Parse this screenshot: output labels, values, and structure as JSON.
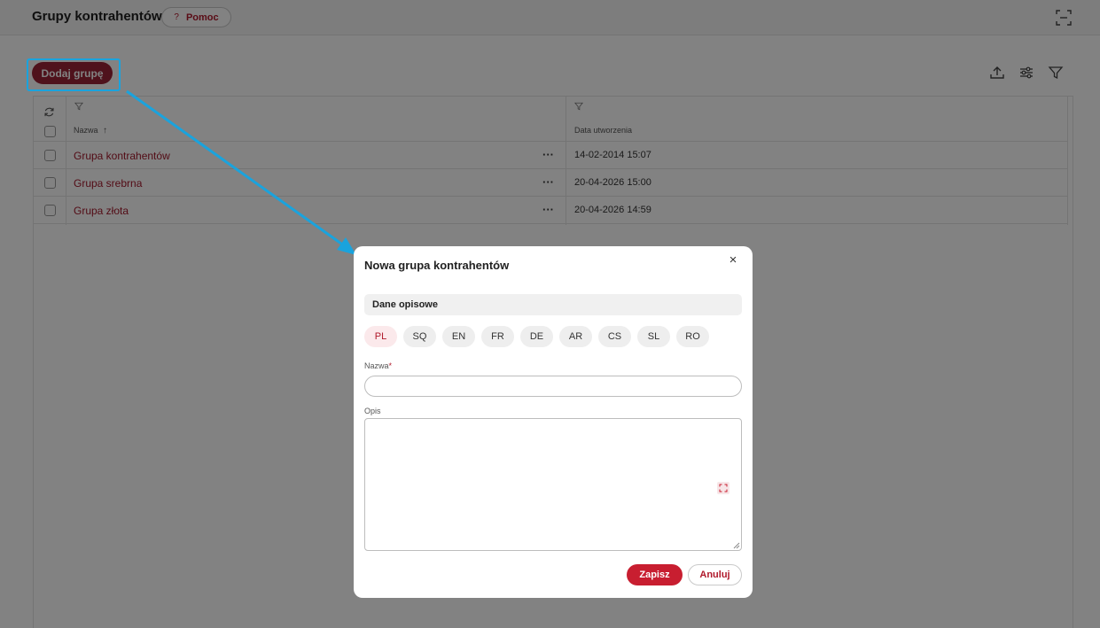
{
  "header": {
    "title": "Grupy kontrahentów",
    "help_label": "Pomoc",
    "help_icon": "?"
  },
  "toolbar": {
    "add_label": "Dodaj grupę"
  },
  "table": {
    "columns": [
      {
        "label": "Nazwa",
        "sort": "↑"
      },
      {
        "label": "Data utworzenia"
      }
    ],
    "rows": [
      {
        "name": "Grupa kontrahentów",
        "date": "14-02-2014 15:07",
        "menu": "···"
      },
      {
        "name": "Grupa srebrna",
        "date": "20-04-2026 15:00",
        "menu": "···"
      },
      {
        "name": "Grupa złota",
        "date": "20-04-2026 14:59",
        "menu": "···"
      }
    ]
  },
  "modal": {
    "title": "Nowa grupa kontrahentów",
    "close": "×",
    "section": "Dane opisowe",
    "languages": [
      "PL",
      "SQ",
      "EN",
      "FR",
      "DE",
      "AR",
      "CS",
      "SL",
      "RO"
    ],
    "active_language": "PL",
    "name_label": "Nazwa",
    "required_mark": "*",
    "name_value": "",
    "desc_label": "Opis",
    "desc_value": "",
    "save_label": "Zapisz",
    "cancel_label": "Anuluj"
  },
  "colors": {
    "primary": "#9b2437",
    "accent_red": "#c81e30",
    "highlight": "#1aa3dd"
  }
}
